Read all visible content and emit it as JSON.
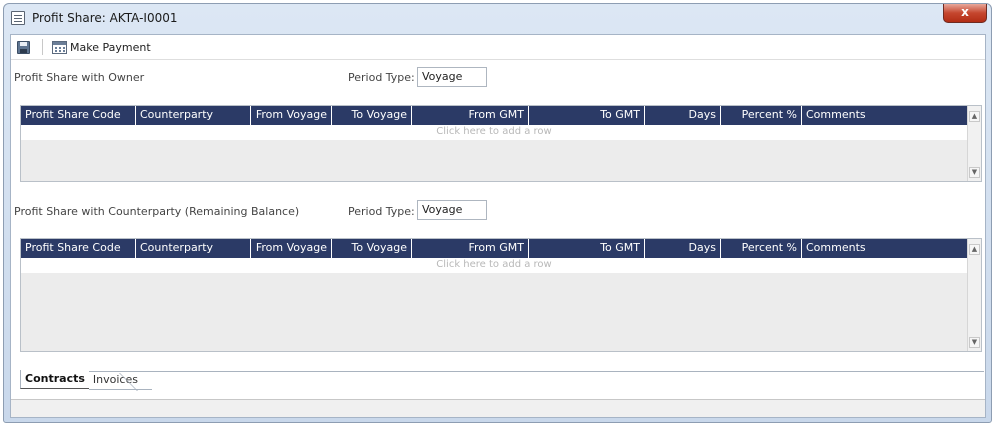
{
  "window": {
    "title": "Profit Share: AKTA-I0001",
    "close_label": "x"
  },
  "toolbar": {
    "save_icon": "save-icon",
    "make_payment_label": "Make Payment",
    "make_payment_icon": "calendar-icon"
  },
  "owner_section": {
    "title": "Profit Share with Owner",
    "period_type_label": "Period Type:",
    "period_type_value": "Voyage",
    "add_row_text": "Click here to add a row"
  },
  "counterparty_section": {
    "title": "Profit Share with Counterparty (Remaining Balance)",
    "period_type_label": "Period Type:",
    "period_type_value": "Voyage",
    "add_row_text": "Click here to add a row"
  },
  "grid_columns": [
    "Profit Share Code",
    "Counterparty",
    "From Voyage",
    "To Voyage",
    "From GMT",
    "To GMT",
    "Days",
    "Percent %",
    "Comments"
  ],
  "tabs": [
    {
      "label": "Contracts",
      "active": true
    },
    {
      "label": "Invoices",
      "active": false
    }
  ],
  "colors": {
    "grid_header_bg": "#2b3a66",
    "grid_body_bg": "#ececec"
  }
}
